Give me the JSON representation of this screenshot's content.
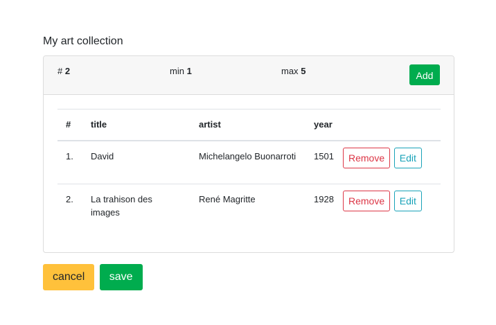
{
  "section": {
    "title": "My art collection"
  },
  "header": {
    "count_label": "#",
    "count_value": "2",
    "min_label": "min",
    "min_value": "1",
    "max_label": "max",
    "max_value": "5",
    "add_label": "Add"
  },
  "table": {
    "columns": [
      "#",
      "title",
      "artist",
      "year"
    ],
    "rows": [
      {
        "num": "1.",
        "title": "David",
        "artist": "Michelangelo Buonarroti",
        "year": "1501"
      },
      {
        "num": "2.",
        "title": "La trahison des images",
        "artist": "René Magritte",
        "year": "1928"
      }
    ],
    "remove_label": "Remove",
    "edit_label": "Edit"
  },
  "footer": {
    "cancel_label": "cancel",
    "save_label": "save"
  },
  "colors": {
    "primary_green": "#00ac4e",
    "cancel_yellow": "#ffc13b",
    "danger_red": "#dc3545",
    "info_teal": "#17a2b8"
  }
}
